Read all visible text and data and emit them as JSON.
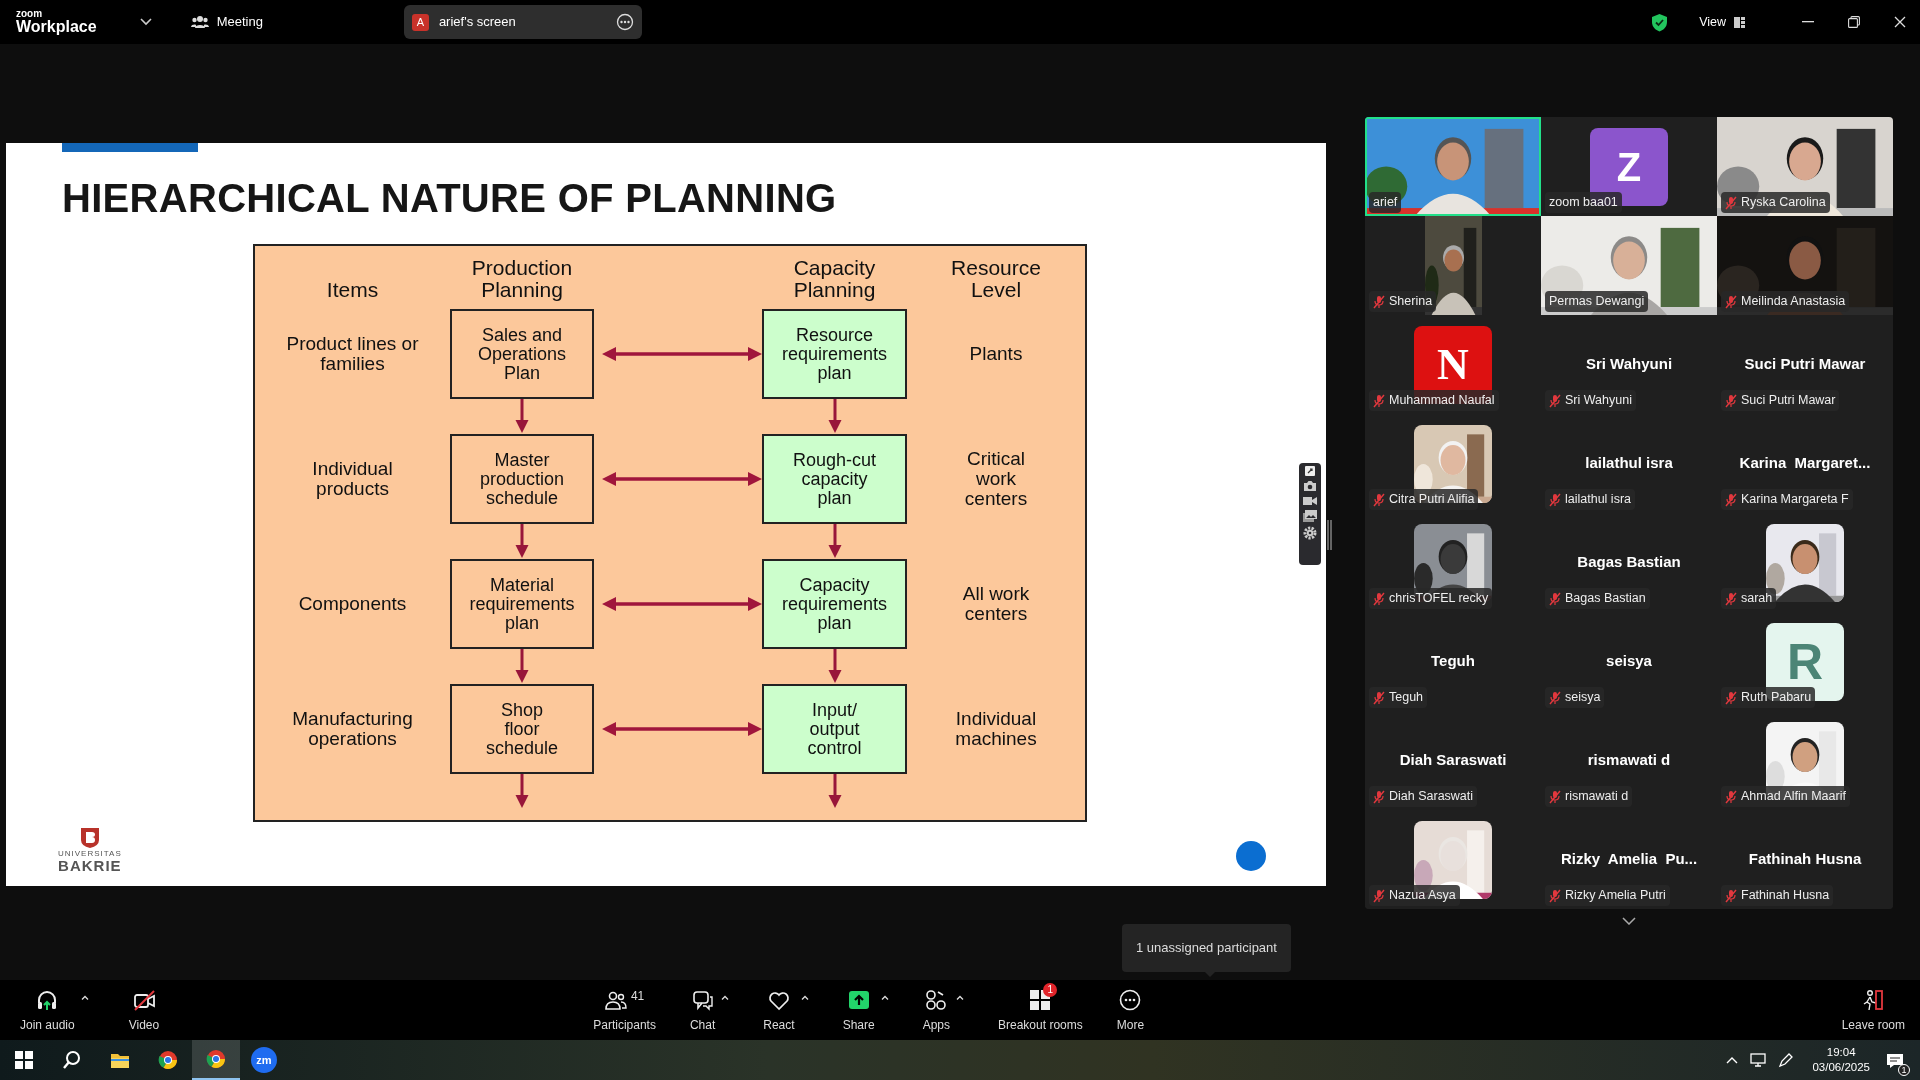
{
  "topbar": {
    "brand_small": "zoom",
    "brand": "Workplace",
    "meeting": "Meeting",
    "share": {
      "initial": "A",
      "label": "arief's screen"
    },
    "view": "View"
  },
  "slide": {
    "title": "HIERARCHICAL NATURE OF PLANNING",
    "headers": [
      "Items",
      "Production\nPlanning",
      "Capacity\nPlanning",
      "Resource\nLevel"
    ],
    "rows": [
      {
        "item": "Product lines or\nfamilies",
        "production": "Sales and\nOperations\nPlan",
        "capacity": "Resource\nrequirements\nplan",
        "resource": "Plants"
      },
      {
        "item": "Individual\nproducts",
        "production": "Master\nproduction\nschedule",
        "capacity": "Rough-cut\ncapacity\nplan",
        "resource": "Critical\nwork\ncenters"
      },
      {
        "item": "Components",
        "production": "Material\nrequirements\nplan",
        "capacity": "Capacity\nrequirements\nplan",
        "resource": "All work\ncenters"
      },
      {
        "item": "Manufacturing\noperations",
        "production": "Shop\nfloor\nschedule",
        "capacity": "Input/\noutput\ncontrol",
        "resource": "Individual\nmachines"
      }
    ],
    "logo": {
      "line1": "UNIVERSITAS",
      "line2": "BAKRIE"
    }
  },
  "participants": [
    {
      "name": "arief",
      "kind": "video",
      "muted": false,
      "active": true
    },
    {
      "name": "zoom baa01",
      "kind": "avatar",
      "letter": "Z",
      "color": "#8b55cc",
      "muted": false,
      "active": false
    },
    {
      "name": "Ryska Carolina",
      "kind": "video",
      "muted": true,
      "active": false
    },
    {
      "name": "Sherina",
      "kind": "portrait",
      "muted": true,
      "active": false
    },
    {
      "name": "Permas Dewangi",
      "kind": "video",
      "muted": false,
      "active": false
    },
    {
      "name": "Meilinda Anastasia",
      "kind": "video",
      "muted": true,
      "active": false
    },
    {
      "name": "Muhammad Naufal",
      "kind": "avatar",
      "letter": "N",
      "color": "#dd1111",
      "muted": true,
      "active": false
    },
    {
      "name": "Sri Wahyuni",
      "kind": "name",
      "title": "Sri Wahyuni",
      "muted": true,
      "active": false
    },
    {
      "name": "Suci Putri Mawar",
      "kind": "name",
      "title": "Suci Putri Mawar",
      "muted": true,
      "active": false
    },
    {
      "name": "Citra Putri Alifia",
      "muted": true,
      "active": false
    },
    {
      "name": "lailathul isra",
      "kind": "name",
      "title": "lailathul isra",
      "muted": true,
      "active": false
    },
    {
      "name": "Karina Margareta F",
      "kind": "name",
      "title": "Karina  Margaret...",
      "muted": true,
      "active": false
    },
    {
      "name": "chrisTOFEL recky",
      "muted": true,
      "active": false
    },
    {
      "name": "Bagas Bastian",
      "kind": "name",
      "title": "Bagas Bastian",
      "muted": true,
      "active": false
    },
    {
      "name": "sarah",
      "muted": true,
      "active": false
    },
    {
      "name": "Teguh",
      "kind": "name",
      "title": "Teguh",
      "muted": true,
      "active": false
    },
    {
      "name": "seisya",
      "kind": "name",
      "title": "seisya",
      "muted": true,
      "active": false
    },
    {
      "name": "Ruth Pabaru",
      "kind": "avatar",
      "letter": "R",
      "color": "#e4f5ee",
      "muted": true,
      "active": false
    },
    {
      "name": "Diah Saraswati",
      "kind": "name",
      "title": "Diah Saraswati",
      "muted": true,
      "active": false
    },
    {
      "name": "rismawati d",
      "kind": "name",
      "title": "rismawati d",
      "muted": true,
      "active": false
    },
    {
      "name": "Ahmad Alfin Maarif",
      "muted": true,
      "active": false
    },
    {
      "name": "Nazua Asya",
      "muted": true,
      "active": false
    },
    {
      "name": "Rizky Amelia Putri",
      "kind": "name",
      "title": "Rizky  Amelia  Pu...",
      "muted": true,
      "active": false
    },
    {
      "name": "Fathinah Husna",
      "kind": "name",
      "title": "Fathinah Husna",
      "muted": true,
      "active": false
    }
  ],
  "tooltip": "1 unassigned participant",
  "toolbar": {
    "left": [
      {
        "label": "Join audio",
        "menu": true
      },
      {
        "label": "Video",
        "menu": false
      }
    ],
    "center": [
      {
        "label": "Participants",
        "count": "41",
        "menu": false
      },
      {
        "label": "Chat",
        "menu": true
      },
      {
        "label": "React",
        "menu": true
      },
      {
        "label": "Share",
        "menu": true
      },
      {
        "label": "Apps",
        "menu": true
      },
      {
        "label": "Breakout rooms",
        "badge": "1",
        "menu": false
      },
      {
        "label": "More",
        "menu": false
      }
    ],
    "right": [
      {
        "label": "Leave room",
        "menu": false
      }
    ]
  },
  "taskbar": {
    "apps": [
      {
        "kind": "start",
        "selected": false
      },
      {
        "kind": "search",
        "selected": false
      },
      {
        "kind": "folder",
        "selected": false
      },
      {
        "kind": "browser",
        "selected": false
      },
      {
        "kind": "browser",
        "selected": true
      },
      {
        "kind": "zoom",
        "label": "zm",
        "selected": false
      }
    ],
    "time": "19:04",
    "date": "03/06/2025",
    "notifications": "1"
  }
}
